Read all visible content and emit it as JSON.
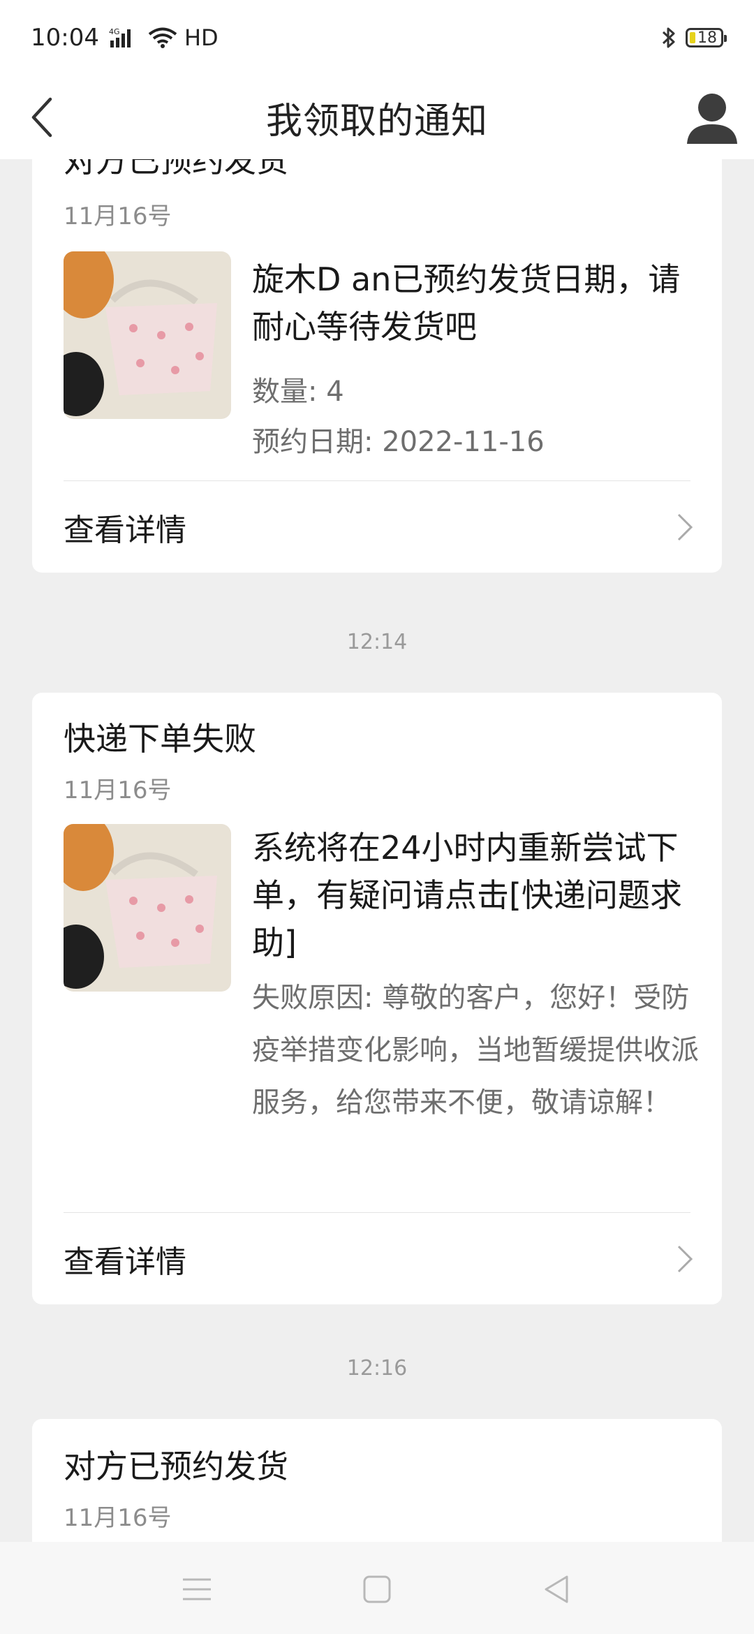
{
  "status_bar": {
    "time": "10:04",
    "network": "4G",
    "hd": "HD",
    "battery": "18"
  },
  "header": {
    "title": "我领取的通知"
  },
  "cards": [
    {
      "title": "对方已预约发货",
      "date": "11月16号",
      "message": "旋木D an已预约发货日期，请耐心等待发货吧",
      "meta": [
        "数量: 4",
        "预约日期: 2022-11-16"
      ],
      "detail_label": "查看详情"
    },
    {
      "title": "快递下单失败",
      "date": "11月16号",
      "message": "系统将在24小时内重新尝试下单，有疑问请点击[快递问题求助]",
      "meta": [
        "失败原因: 尊敬的客户，您好！受防疫举措变化影响，当地暂缓提供收派服务，给您带来不便，敬请谅解！"
      ],
      "detail_label": "查看详情"
    },
    {
      "title": "对方已预约发货",
      "date": "11月16号"
    }
  ],
  "timestamps": [
    "12:14",
    "12:16"
  ],
  "colors": {
    "page_bg": "#efefef",
    "card_bg": "#ffffff",
    "secondary_text": "#8c8c8c",
    "battery_fill": "#e6d21b"
  },
  "icons": {
    "back": "chevron-left-icon",
    "user": "user-icon",
    "detail_arrow": "chevron-right-icon",
    "nav_menu": "menu-icon",
    "nav_home": "home-square-icon",
    "nav_back": "triangle-back-icon"
  }
}
